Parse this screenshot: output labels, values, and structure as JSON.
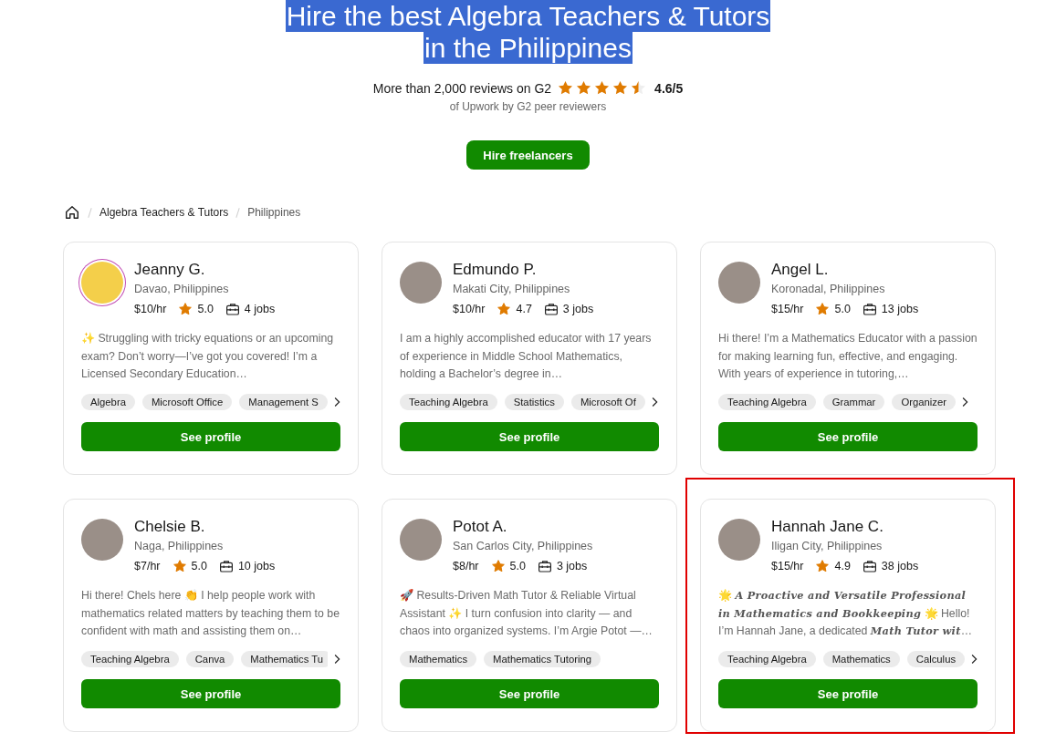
{
  "hero": {
    "title_lines": [
      "Hire the best Algebra Teachers & Tutors",
      "in the Philippines"
    ],
    "title_selected": true,
    "reviews": {
      "text": "More than 2,000 reviews on G2",
      "stars": 4.5,
      "score": "4.6/5",
      "subtext": "of Upwork by G2 peer reviewers"
    },
    "cta": "Hire freelancers"
  },
  "breadcrumb": [
    "Algebra Teachers & Tutors",
    "Philippines"
  ],
  "cards": [
    {
      "name": "Jeanny G.",
      "location": "Davao, Philippines",
      "rate": "$10/hr",
      "rating": "5.0",
      "jobs": "4 jobs",
      "avatar_ring": true,
      "highlighted": false,
      "bio": "✨ Struggling with tricky equations or an upcoming exam? Don’t worry—I’ve got you covered! I’m a Licensed Secondary Education…",
      "skills": [
        "Algebra",
        "Microsoft Office",
        "Management S"
      ],
      "more_skills": true,
      "button": "See profile"
    },
    {
      "name": "Edmundo P.",
      "location": "Makati City, Philippines",
      "rate": "$10/hr",
      "rating": "4.7",
      "jobs": "3 jobs",
      "avatar_ring": false,
      "highlighted": false,
      "bio": "I am a highly accomplished educator with 17 years of experience in Middle School Mathematics, holding a Bachelor’s degree in…",
      "skills": [
        "Teaching Algebra",
        "Statistics",
        "Microsoft Of"
      ],
      "more_skills": true,
      "button": "See profile"
    },
    {
      "name": "Angel L.",
      "location": "Koronadal, Philippines",
      "rate": "$15/hr",
      "rating": "5.0",
      "jobs": "13 jobs",
      "avatar_ring": false,
      "highlighted": false,
      "bio": "Hi there! I’m a Mathematics Educator with a passion for making learning fun, effective, and engaging. With years of experience in tutoring,…",
      "skills": [
        "Teaching Algebra",
        "Grammar",
        "Organizer"
      ],
      "more_skills": true,
      "button": "See profile"
    },
    {
      "name": "Chelsie B.",
      "location": "Naga, Philippines",
      "rate": "$7/hr",
      "rating": "5.0",
      "jobs": "10 jobs",
      "avatar_ring": false,
      "highlighted": false,
      "bio": "Hi there! Chels here 👏 I help people work with mathematics related matters by teaching them to be confident with math and assisting them on…",
      "skills": [
        "Teaching Algebra",
        "Canva",
        "Mathematics Tu"
      ],
      "more_skills": true,
      "button": "See profile"
    },
    {
      "name": "Potot A.",
      "location": "San Carlos City, Philippines",
      "rate": "$8/hr",
      "rating": "5.0",
      "jobs": "3 jobs",
      "avatar_ring": false,
      "highlighted": false,
      "bio": "🚀 Results-Driven Math Tutor & Reliable Virtual Assistant ✨ I turn confusion into clarity — and chaos into organized systems. I’m Argie Potot —…",
      "skills": [
        "Mathematics",
        "Mathematics Tutoring"
      ],
      "more_skills": false,
      "button": "See profile"
    },
    {
      "name": "Hannah Jane C.",
      "location": "Iligan City, Philippines",
      "rate": "$15/hr",
      "rating": "4.9",
      "jobs": "38 jobs",
      "avatar_ring": false,
      "highlighted": true,
      "bio": "🌟 **A Proactive and Versatile Professional in Mathematics and Bookkeeping** 🌟 Hello! I’m Hannah Jane, a dedicated **Math Tutor wit**…",
      "skills": [
        "Teaching Algebra",
        "Mathematics",
        "Calculus"
      ],
      "more_skills": true,
      "button": "See profile"
    }
  ]
}
